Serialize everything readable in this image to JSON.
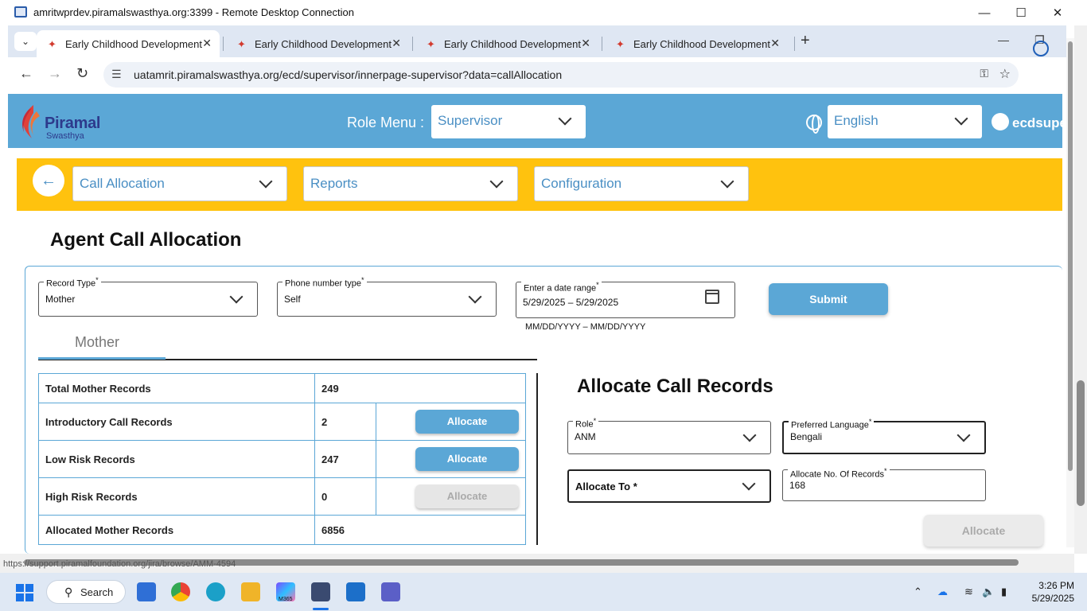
{
  "rdp": {
    "title": "amritwprdev.piramalswasthya.org:3399 - Remote Desktop Connection",
    "minimize_icon": "minimize-icon",
    "maximize_icon": "maximize-icon",
    "close_icon": "close-icon"
  },
  "browser": {
    "tabs": [
      {
        "label": "Early Childhood Development",
        "active": true
      },
      {
        "label": "Early Childhood Development",
        "active": false
      },
      {
        "label": "Early Childhood Development",
        "active": false
      },
      {
        "label": "Early Childhood Development",
        "active": false
      }
    ],
    "url": "uatamrit.piramalswasthya.org/ecd/supervisor/innerpage-supervisor?data=callAllocation",
    "status_url": "https://support.piramalfoundation.org/jira/browse/AMM-4594"
  },
  "header": {
    "brand": "Piramal",
    "brand_sub": "Swasthya",
    "role_label": "Role Menu :",
    "role_value": "Supervisor",
    "language_value": "English",
    "username": "ecdsupe"
  },
  "menu": {
    "items": [
      {
        "label": "Call Allocation"
      },
      {
        "label": "Reports"
      },
      {
        "label": "Configuration"
      }
    ]
  },
  "page": {
    "title": "Agent Call Allocation",
    "filters": {
      "record_type_label": "Record Type",
      "record_type_value": "Mother",
      "phone_type_label": "Phone number type",
      "phone_type_value": "Self",
      "date_range_label": "Enter a date range",
      "date_range_value": "5/29/2025  –  5/29/2025",
      "date_hint": "MM/DD/YYYY – MM/DD/YYYY",
      "required_mark": "*"
    },
    "submit_label": "Submit",
    "tab_label": "Mother",
    "stats": [
      {
        "label": "Total Mother Records",
        "value": "249",
        "button": null
      },
      {
        "label": "Introductory Call Records",
        "value": "2",
        "button": "Allocate",
        "enabled": true
      },
      {
        "label": "Low Risk Records",
        "value": "247",
        "button": "Allocate",
        "enabled": true
      },
      {
        "label": "High Risk Records",
        "value": "0",
        "button": "Allocate",
        "enabled": false
      },
      {
        "label": "Allocated Mother Records",
        "value": "6856",
        "button": null
      }
    ],
    "allocate": {
      "title": "Allocate Call Records",
      "role_label": "Role",
      "role_value": "ANM",
      "language_label": "Preferred Language",
      "language_value": "Bengali",
      "allocate_to_label": "Allocate To *",
      "count_label": "Allocate No. Of Records",
      "count_value": "168",
      "button_label": "Allocate"
    }
  },
  "taskbar": {
    "search_label": "Search",
    "time": "3:26 PM",
    "date": "5/29/2025",
    "m365_label": "M365"
  },
  "colors": {
    "header_blue": "#5ba7d6",
    "menu_yellow": "#ffc20e",
    "accent_text": "#4a8fc4"
  }
}
